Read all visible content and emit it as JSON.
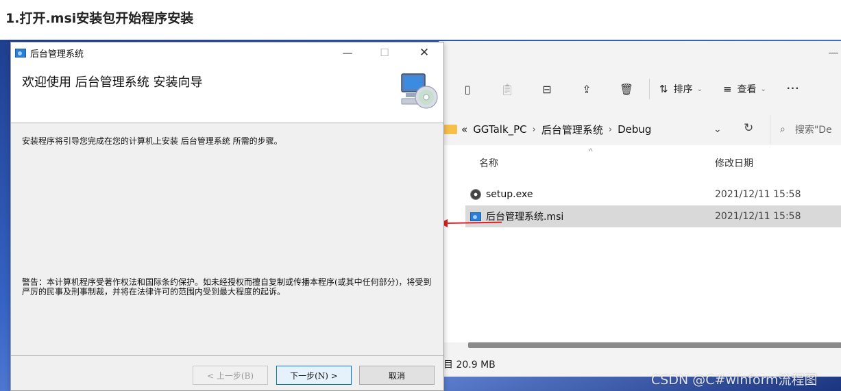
{
  "heading": "1.打开.msi安装包开始程序安装",
  "explorer": {
    "minimize_glyph": "—",
    "toolbar": {
      "icons": [
        "copy-icon",
        "paste-icon",
        "rename-icon",
        "share-icon",
        "delete-icon"
      ],
      "sort_label": "排序",
      "view_label": "查看",
      "more_label": "···"
    },
    "address": {
      "overflow": "«",
      "crumbs": [
        "GGTalk_PC",
        "后台管理系统",
        "Debug"
      ],
      "search_placeholder": "搜索\"De"
    },
    "columns": {
      "name": "名称",
      "date": "修改日期"
    },
    "files": [
      {
        "name": "setup.exe",
        "date": "2021/12/11 15:58",
        "icon": "exe-icon",
        "selected": false
      },
      {
        "name": "后台管理系统.msi",
        "date": "2021/12/11 15:58",
        "icon": "msi-icon",
        "selected": true
      }
    ],
    "status": "目 20.9 MB"
  },
  "dialog": {
    "title": "后台管理系统",
    "heading": "欢迎使用 后台管理系统 安装向导",
    "intro": "安装程序将引导您完成在您的计算机上安装 后台管理系统 所需的步骤。",
    "warning": "警告：本计算机程序受著作权法和国际条约保护。如未经授权而擅自复制或传播本程序(或其中任何部分)，将受到严厉的民事及刑事制裁，并将在法律许可的范围内受到最大程度的起诉。",
    "buttons": {
      "back": "< 上一步(B)",
      "next": "下一步(N) >",
      "cancel": "取消"
    },
    "window_controls": {
      "minimize": "—",
      "maximize": "☐",
      "close": "✕"
    }
  },
  "watermark": "CSDN @C#winform流程图",
  "colors": {
    "arrow": "#e02020",
    "accent": "#0078d7",
    "selected_row": "#d9d9d9"
  }
}
